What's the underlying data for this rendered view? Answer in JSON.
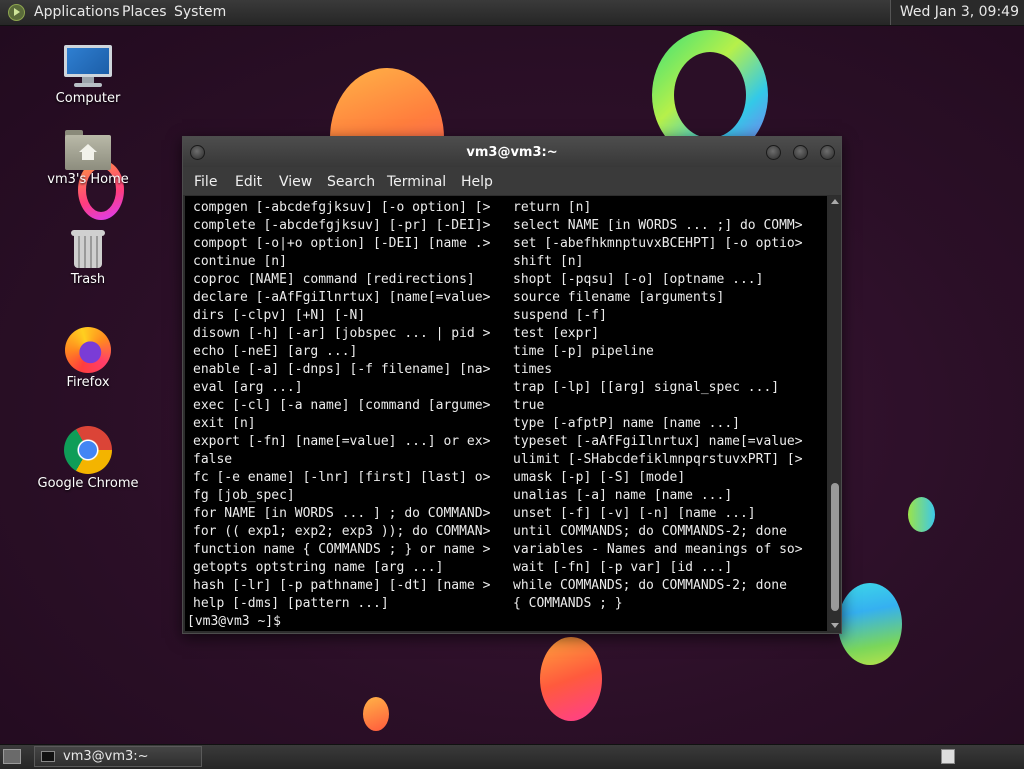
{
  "top_panel": {
    "menus": [
      "Applications",
      "Places",
      "System"
    ],
    "clock": "Wed Jan  3, 09:49"
  },
  "desktop_icons": [
    {
      "label": "Computer",
      "icon": "computer-icon"
    },
    {
      "label": "vm3's Home",
      "icon": "home-folder-icon"
    },
    {
      "label": "Trash",
      "icon": "trash-icon"
    },
    {
      "label": "Firefox",
      "icon": "firefox-icon"
    },
    {
      "label": "Google Chrome",
      "icon": "chrome-icon"
    }
  ],
  "terminal": {
    "title": "vm3@vm3:~",
    "menu": [
      "File",
      "Edit",
      "View",
      "Search",
      "Terminal",
      "Help"
    ],
    "left_column": [
      "compgen [-abcdefgjksuv] [-o option] [>",
      "complete [-abcdefgjksuv] [-pr] [-DEI]>",
      "compopt [-o|+o option] [-DEI] [name .>",
      "continue [n]",
      "coproc [NAME] command [redirections]",
      "declare [-aAfFgiIlnrtux] [name[=value>",
      "dirs [-clpv] [+N] [-N]",
      "disown [-h] [-ar] [jobspec ... | pid >",
      "echo [-neE] [arg ...]",
      "enable [-a] [-dnps] [-f filename] [na>",
      "eval [arg ...]",
      "exec [-cl] [-a name] [command [argume>",
      "exit [n]",
      "export [-fn] [name[=value] ...] or ex>",
      "false",
      "fc [-e ename] [-lnr] [first] [last] o>",
      "fg [job_spec]",
      "for NAME [in WORDS ... ] ; do COMMAND>",
      "for (( exp1; exp2; exp3 )); do COMMAN>",
      "function name { COMMANDS ; } or name >",
      "getopts optstring name [arg ...]",
      "hash [-lr] [-p pathname] [-dt] [name >",
      "help [-dms] [pattern ...]"
    ],
    "right_column": [
      "return [n]",
      "select NAME [in WORDS ... ;] do COMM>",
      "set [-abefhkmnptuvxBCEHPT] [-o optio>",
      "shift [n]",
      "shopt [-pqsu] [-o] [optname ...]",
      "source filename [arguments]",
      "suspend [-f]",
      "test [expr]",
      "time [-p] pipeline",
      "times",
      "trap [-lp] [[arg] signal_spec ...]",
      "true",
      "type [-afptP] name [name ...]",
      "typeset [-aAfFgiIlnrtux] name[=value>",
      "ulimit [-SHabcdefiklmnpqrstuvxPRT] [>",
      "umask [-p] [-S] [mode]",
      "unalias [-a] name [name ...]",
      "unset [-f] [-v] [-n] [name ...]",
      "until COMMANDS; do COMMANDS-2; done",
      "variables - Names and meanings of so>",
      "wait [-fn] [-p var] [id ...]",
      "while COMMANDS; do COMMANDS-2; done",
      "{ COMMANDS ; }"
    ],
    "prompt": "[vm3@vm3 ~]$ "
  },
  "bottom_panel": {
    "task_label": "vm3@vm3:~"
  }
}
